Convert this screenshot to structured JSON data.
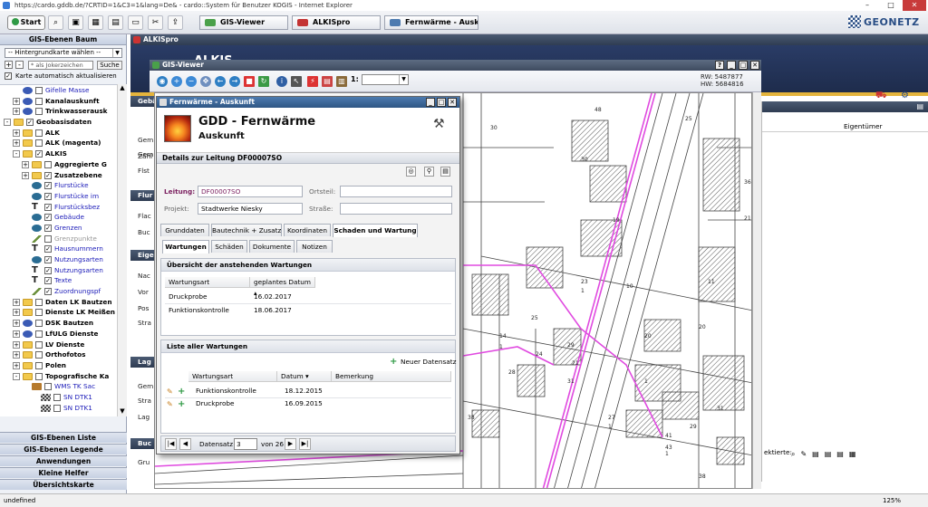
{
  "browser": {
    "title": "https://cardo.gddb.de/?CRTID=1&C3=1&lang=De& - cardo::System für Benutzer KOGIS - Internet Explorer",
    "minimize": "–",
    "maximize": "□",
    "close": "✕"
  },
  "toolbar": {
    "start_label": "Start",
    "tasks": [
      {
        "label": "GIS-Viewer",
        "color": "#4aa04a"
      },
      {
        "label": "ALKISpro",
        "color": "#c33333"
      },
      {
        "label": "Fernwärme - Auskunft",
        "color": "#4d7bb0"
      }
    ],
    "logo": "GEONETZ"
  },
  "sidebar": {
    "title": "GIS-Ebenen Baum",
    "background_select": "-- Hintergrundkarte wählen --",
    "plus": "+",
    "minus": "-",
    "search_placeholder": "* als Jokerzeichen",
    "search_button": "Suche",
    "auto_update": "Karte automatisch aktualisieren",
    "tree": [
      {
        "indent": 1,
        "pm": "",
        "icon": "layers",
        "checked": false,
        "label": "Gifelle Masse",
        "style": "blue"
      },
      {
        "indent": 1,
        "pm": "+",
        "icon": "layers",
        "checked": false,
        "label": "Kanalauskunft",
        "style": "bold"
      },
      {
        "indent": 1,
        "pm": "+",
        "icon": "layers",
        "checked": false,
        "label": "Trinkwasserausk",
        "style": "bold"
      },
      {
        "indent": 0,
        "pm": "-",
        "icon": "folder",
        "checked": true,
        "label": "Geobasisdaten",
        "style": "bold"
      },
      {
        "indent": 1,
        "pm": "+",
        "icon": "folder",
        "checked": false,
        "label": "ALK",
        "style": "bold"
      },
      {
        "indent": 1,
        "pm": "+",
        "icon": "folder",
        "checked": false,
        "label": "ALK (magenta)",
        "style": "bold"
      },
      {
        "indent": 1,
        "pm": "-",
        "icon": "folder",
        "checked": true,
        "label": "ALKIS",
        "style": "bold"
      },
      {
        "indent": 2,
        "pm": "+",
        "icon": "folder",
        "checked": false,
        "label": "Aggregierte G",
        "style": "bold"
      },
      {
        "indent": 2,
        "pm": "+",
        "icon": "folder",
        "checked": true,
        "label": "Zusatzebene",
        "style": "bold"
      },
      {
        "indent": 2,
        "pm": "",
        "icon": "shape",
        "checked": true,
        "label": "Flurstücke",
        "style": "blue"
      },
      {
        "indent": 2,
        "pm": "",
        "icon": "shape",
        "checked": true,
        "label": "Flurstücke im",
        "style": "blue"
      },
      {
        "indent": 2,
        "pm": "",
        "icon": "txt",
        "checked": true,
        "label": "Flurstücksbez",
        "style": "blue"
      },
      {
        "indent": 2,
        "pm": "",
        "icon": "shape",
        "checked": true,
        "label": "Gebäude",
        "style": "blue"
      },
      {
        "indent": 2,
        "pm": "",
        "icon": "shape",
        "checked": true,
        "label": "Grenzen",
        "style": "blue"
      },
      {
        "indent": 2,
        "pm": "",
        "icon": "pen",
        "checked": false,
        "label": "Grenzpunkte",
        "style": "gray"
      },
      {
        "indent": 2,
        "pm": "",
        "icon": "txt",
        "checked": true,
        "label": "Hausnummern",
        "style": "blue"
      },
      {
        "indent": 2,
        "pm": "",
        "icon": "shape",
        "checked": true,
        "label": "Nutzungsarten",
        "style": "blue"
      },
      {
        "indent": 2,
        "pm": "",
        "icon": "txt",
        "checked": true,
        "label": "Nutzungsarten",
        "style": "blue"
      },
      {
        "indent": 2,
        "pm": "",
        "icon": "txt",
        "checked": true,
        "label": "Texte",
        "style": "blue"
      },
      {
        "indent": 2,
        "pm": "",
        "icon": "pen",
        "checked": true,
        "label": "Zuordnungspf",
        "style": "blue"
      },
      {
        "indent": 1,
        "pm": "+",
        "icon": "folder",
        "checked": false,
        "label": "Daten LK Bautzen",
        "style": "bold"
      },
      {
        "indent": 1,
        "pm": "+",
        "icon": "folder",
        "checked": false,
        "label": "Dienste LK Meißen",
        "style": "bold"
      },
      {
        "indent": 1,
        "pm": "+",
        "icon": "layers",
        "checked": false,
        "label": "DSK Bautzen",
        "style": "bold"
      },
      {
        "indent": 1,
        "pm": "+",
        "icon": "layers",
        "checked": false,
        "label": "LfULG Dienste",
        "style": "bold"
      },
      {
        "indent": 1,
        "pm": "+",
        "icon": "folder",
        "checked": false,
        "label": "LV Dienste",
        "style": "bold"
      },
      {
        "indent": 1,
        "pm": "+",
        "icon": "folder",
        "checked": false,
        "label": "Orthofotos",
        "style": "bold"
      },
      {
        "indent": 1,
        "pm": "+",
        "icon": "folder",
        "checked": false,
        "label": "Polen",
        "style": "bold"
      },
      {
        "indent": 1,
        "pm": "-",
        "icon": "folder",
        "checked": false,
        "label": "Topografische Ka",
        "style": "bold"
      },
      {
        "indent": 2,
        "pm": "",
        "icon": "wms",
        "checked": false,
        "label": "WMS TK Sac",
        "style": "blue"
      },
      {
        "indent": 3,
        "pm": "",
        "icon": "grid",
        "checked": false,
        "label": "SN DTK1",
        "style": "blue"
      },
      {
        "indent": 3,
        "pm": "",
        "icon": "grid",
        "checked": false,
        "label": "SN DTK1",
        "style": "blue"
      }
    ],
    "accordion": [
      "GIS-Ebenen Liste",
      "GIS-Ebenen Legende",
      "Anwendungen",
      "Kleine Helfer",
      "Übersichtskarte"
    ]
  },
  "alkis": {
    "title": "ALKISpro",
    "header_text": "ALKIS",
    "side_items": [
      "Gebä",
      "Gem",
      "Gem",
      "Zähl",
      "Flst",
      "Flur",
      "Flac",
      "Buc",
      "Eige",
      "Nac",
      "Vor",
      "Pos",
      "Stra",
      "Lag",
      "Gem",
      "Stra",
      "Lag",
      "Buc",
      "Gru"
    ],
    "right_col_header": "Eigentümer",
    "right_footer": "ektierte:"
  },
  "gis": {
    "title": "GIS-Viewer",
    "scale_label": "1:",
    "rw": "RW: 5487877",
    "hw": "HW: 5684816"
  },
  "fw": {
    "title": "Fernwärme - Auskunft",
    "heading": "GDD - Fernwärme",
    "subheading": "Auskunft",
    "details": "Details zur Leitung DF00007SO",
    "leitung_label": "Leitung:",
    "leitung_value": "DF00007SO",
    "projekt_label": "Projekt:",
    "projekt_value": "Stadtwerke Niesky",
    "ortsteil_label": "Ortsteil:",
    "strasse_label": "Straße:",
    "tabs": [
      "Grunddaten",
      "Bautechnik + Zusatz",
      "Koordinaten",
      "Schaden und Wartung"
    ],
    "subtabs": [
      "Wartungen",
      "Schäden",
      "Dokumente",
      "Notizen"
    ],
    "overview_title": "Übersicht der anstehenden Wartungen",
    "col_art": "Wartungsart",
    "col_datum_geplant": "geplantes Datum",
    "upcoming": [
      {
        "art": "Druckprobe",
        "datum": "16.02.2017"
      },
      {
        "art": "Funktionskontrolle",
        "datum": "18.06.2017"
      }
    ],
    "list_title": "Liste aller Wartungen",
    "new_record": "Neuer Datensatz",
    "col_datum": "Datum",
    "col_bemerkung": "Bemerkung",
    "all": [
      {
        "art": "Funktionskontrolle",
        "datum": "18.12.2015",
        "bemerkung": ""
      },
      {
        "art": "Druckprobe",
        "datum": "16.09.2015",
        "bemerkung": ""
      }
    ],
    "pager_label": "Datensatz",
    "pager_value": "3",
    "pager_of": "von 26"
  },
  "map": {
    "labels": [
      "48",
      "23",
      "1",
      "25",
      "21",
      "31",
      "28",
      "31",
      "29",
      "1",
      "27",
      "1",
      "24",
      "20",
      "20",
      "10",
      "11",
      "25",
      "36",
      "21",
      "38",
      "30",
      "19",
      "41",
      "43",
      "1",
      "38",
      "14",
      "1",
      "29",
      "30"
    ]
  },
  "status": {
    "left": "undefined",
    "zoom": "125%"
  }
}
